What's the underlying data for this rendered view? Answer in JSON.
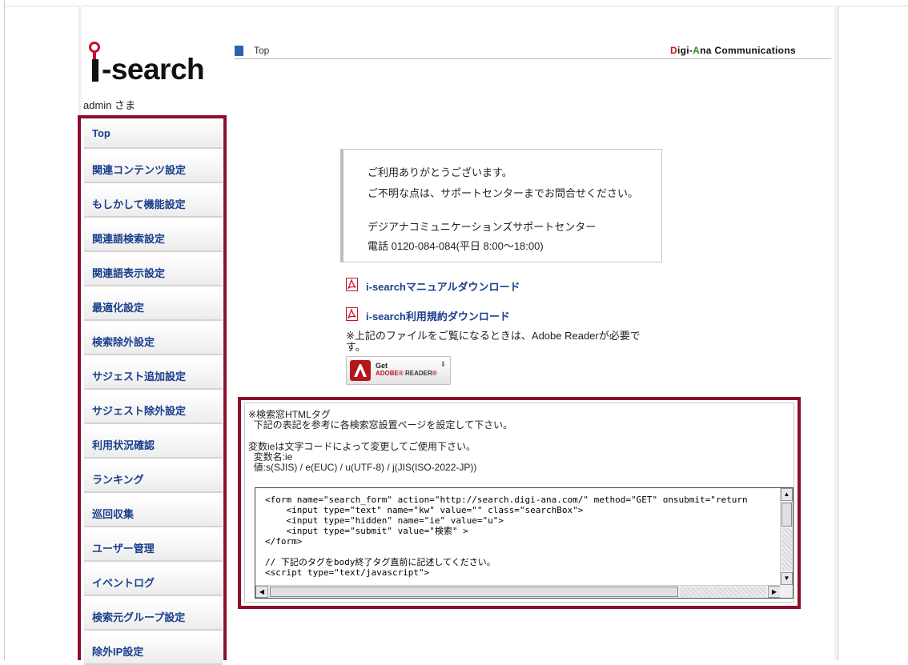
{
  "logo": {
    "text": "-search"
  },
  "user": {
    "label": "admin さま"
  },
  "header": {
    "breadcrumb": "Top",
    "company": {
      "part1": "D",
      "part2": "igi-",
      "part3": "A",
      "part4": "na Communications"
    }
  },
  "sidebar": {
    "items": [
      {
        "label": "Top"
      },
      {
        "label": "関連コンテンツ設定"
      },
      {
        "label": "もしかして機能設定"
      },
      {
        "label": "関連語検索設定"
      },
      {
        "label": "関連語表示設定"
      },
      {
        "label": "最適化設定"
      },
      {
        "label": "検索除外設定"
      },
      {
        "label": "サジェスト追加設定"
      },
      {
        "label": "サジェスト除外設定"
      },
      {
        "label": "利用状況確認"
      },
      {
        "label": "ランキング"
      },
      {
        "label": "巡回収集"
      },
      {
        "label": "ユーザー管理"
      },
      {
        "label": "イベントログ"
      },
      {
        "label": "検索元グループ設定"
      },
      {
        "label": "除外IP設定"
      }
    ]
  },
  "notice": {
    "line1": "ご利用ありがとうございます。",
    "line2": "ご不明な点は、サポートセンターまでお問合せください。",
    "line3": "デジアナコミュニケーションズサポートセンター",
    "line4": "電話 0120-084-084(平日 8:00〜18:00)"
  },
  "downloads": {
    "manual": "i-searchマニュアルダウンロード",
    "terms": "i-search利用規約ダウンロード",
    "note": "※上記のファイルをご覧になるときは、Adobe Readerが必要です。",
    "reader_get": "Get",
    "reader_adobe": "ADOBE",
    "reader_name": "READER"
  },
  "code_section": {
    "title": "※検索窓HTMLタグ",
    "desc": "  下記の表記を参考に各検索窓設置ページを設定して下さい。",
    "var_note": "変数ieは文字コードによって変更してご使用下さい。",
    "var_name": "  変数名:ie",
    "var_values": "  値:s(SJIS) / e(EUC) / u(UTF-8) / j(JIS(ISO-2022-JP))",
    "code": "<form name=\"search_form\" action=\"http://search.digi-ana.com/\" method=\"GET\" onsubmit=\"return\n    <input type=\"text\" name=\"kw\" value=\"\" class=\"searchBox\">\n    <input type=\"hidden\" name=\"ie\" value=\"u\">\n    <input type=\"submit\" value=\"検索\" >\n</form>\n\n// 下記のタグをbody終了タグ直前に記述してください。\n<script type=\"text/javascript\">"
  }
}
